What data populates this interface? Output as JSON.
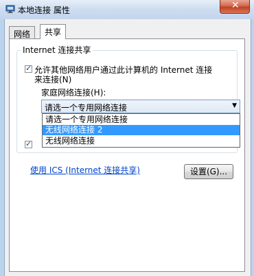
{
  "window": {
    "title": "本地连接 属性",
    "close_glyph": "✕"
  },
  "tabs": [
    {
      "label": "网络",
      "selected": false
    },
    {
      "label": "共享",
      "selected": true
    }
  ],
  "sharing": {
    "group_title": "Internet 连接共享",
    "allow_checkbox": {
      "checked": true,
      "label_line1": "允许其他网络用户通过此计算机的 Internet 连接",
      "label_line2": "来连接(N)"
    },
    "home_network_label": "家庭网络连接(H):",
    "combo": {
      "selected": "请选一个专用网络连接",
      "arrow": "▼"
    },
    "dropdown_options": [
      {
        "label": "请选一个专用网络连接",
        "highlighted": false
      },
      {
        "label": "无线网络连接 2",
        "highlighted": true
      },
      {
        "label": "无线网络连接",
        "highlighted": false
      }
    ],
    "second_checkbox": {
      "checked": true
    }
  },
  "footer": {
    "ics_link": "使用 ICS (Internet 连接共享)",
    "settings_button": "设置(G)..."
  },
  "colors": {
    "highlight": "#3399ff",
    "link": "#0044cc"
  },
  "icons": [
    "network-connection-icon",
    "close-icon",
    "chevron-down-icon",
    "checkbox-check-icon"
  ]
}
